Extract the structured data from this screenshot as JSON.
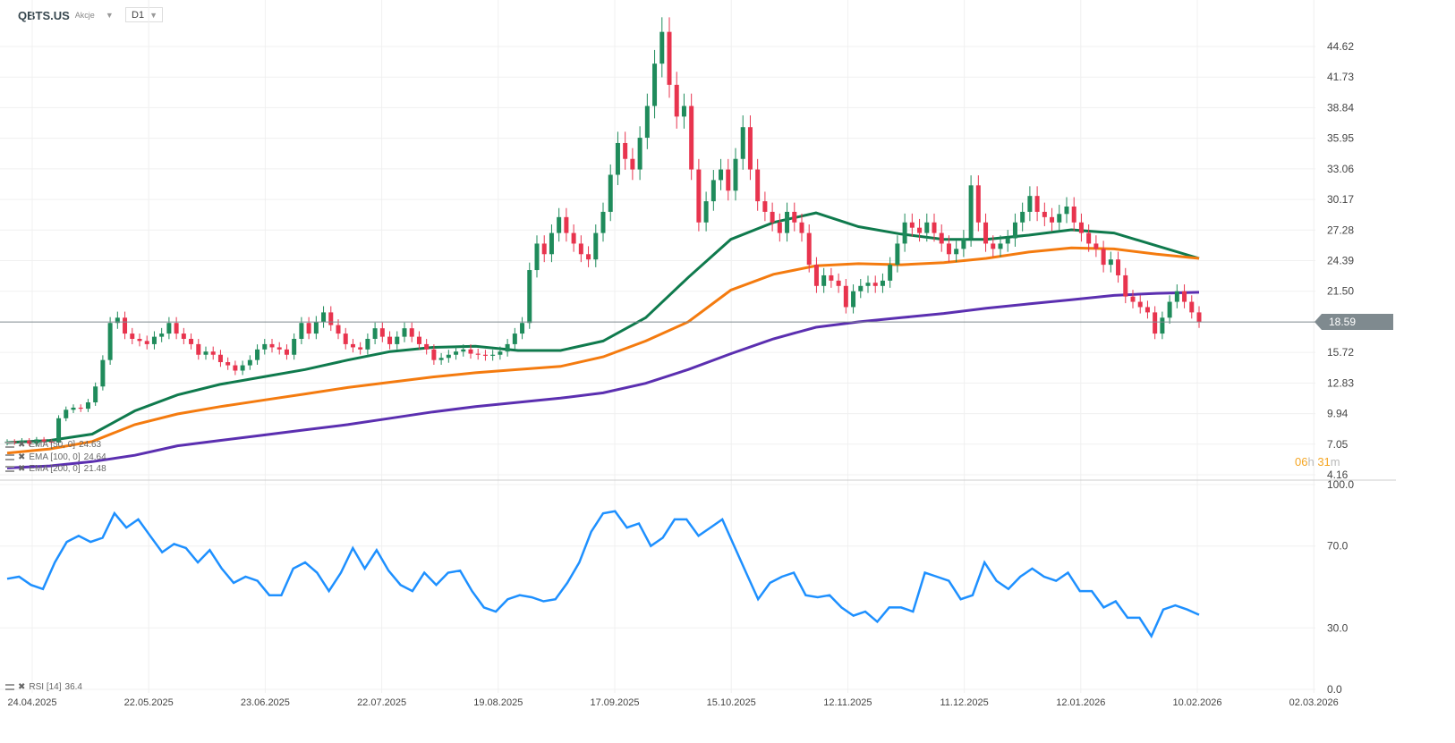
{
  "header": {
    "symbol": "QBTS.US",
    "asset_type": "Akcje",
    "timeframe": "D1"
  },
  "countdown": {
    "hours": "06",
    "h": "h",
    "minutes": "31",
    "m": "m"
  },
  "colors": {
    "up": "#1f8b5b",
    "down": "#e8344e",
    "ema50": "#0f7a4d",
    "ema100": "#f47b0f",
    "ema200": "#5b2fb0",
    "rsi": "#1e90ff",
    "last_price": "#7f8a8f"
  },
  "legend": [
    {
      "label": "EMA [50, 0]",
      "value": "24.63"
    },
    {
      "label": "EMA [100, 0]",
      "value": "24.64"
    },
    {
      "label": "EMA [200, 0]",
      "value": "21.48"
    }
  ],
  "rsi_legend": {
    "label": "RSI [14]",
    "value": "36.4"
  },
  "chart_data": [
    {
      "type": "candlestick",
      "last_price": "18.59",
      "x_range": [
        "24.04.2025",
        "10.02.2026"
      ],
      "x_ticks": [
        "24.04.2025",
        "22.05.2025",
        "23.06.2025",
        "22.07.2025",
        "19.08.2025",
        "17.09.2025",
        "15.10.2025",
        "12.11.2025",
        "11.12.2025",
        "12.01.2026",
        "10.02.2026",
        "02.03.2026"
      ],
      "y_ticks": [
        "44.62",
        "41.73",
        "38.84",
        "35.95",
        "33.06",
        "30.17",
        "27.28",
        "24.39",
        "21.50",
        "15.72",
        "12.83",
        "9.94",
        "7.05",
        "4.16"
      ],
      "ylim": [
        4.16,
        44.62
      ],
      "closes": [
        7.3,
        7.2,
        7.4,
        7.1,
        7.5,
        7.3,
        7.2,
        9.5,
        10.3,
        10.5,
        10.4,
        11,
        12.5,
        15,
        18.5,
        19,
        17.5,
        17,
        16.8,
        16.5,
        17.2,
        17.5,
        18.5,
        17.5,
        17,
        16.5,
        15.5,
        15.8,
        15.5,
        14.8,
        14.5,
        14,
        14.5,
        15,
        16,
        16.5,
        16.2,
        16,
        15.5,
        17,
        18.5,
        17.5,
        18.6,
        19.5,
        18.3,
        17.5,
        16.5,
        16.2,
        16,
        17,
        18,
        17.2,
        16.5,
        17.2,
        18,
        17.2,
        16.5,
        16,
        15,
        15.2,
        15.5,
        15.8,
        16,
        15.6,
        15.5,
        15.4,
        15.5,
        15.8,
        16.5,
        17.5,
        18.5,
        23.5,
        26,
        25,
        27,
        28.5,
        27,
        26,
        25,
        24.5,
        27,
        29,
        32.5,
        35.5,
        34,
        33,
        36,
        39,
        43,
        46,
        41,
        38,
        39,
        33,
        28,
        30,
        32,
        33,
        31,
        34,
        37,
        33,
        30,
        29,
        28,
        27,
        29,
        28,
        27,
        24,
        22,
        23,
        22.5,
        22,
        20,
        21.5,
        22,
        22.3,
        22,
        22.5,
        24,
        26,
        28,
        27.5,
        27,
        28,
        27,
        26,
        25,
        25.5,
        26.5,
        31.5,
        28,
        26,
        25.5,
        26,
        26.5,
        28,
        29,
        30.5,
        29,
        28.5,
        28,
        28.8,
        29.5,
        28,
        27,
        26,
        25.5,
        24,
        24.5,
        23,
        21,
        20.5,
        20,
        19.5,
        17.5,
        19,
        20.5,
        21.5,
        20.5,
        19.5,
        18.59
      ],
      "series": [
        {
          "name": "EMA [50, 0]",
          "values": [
            7.2,
            7.4,
            8.0,
            10.2,
            11.7,
            12.7,
            13.4,
            14.1,
            15.0,
            15.8,
            16.2,
            16.3,
            15.9,
            15.9,
            16.8,
            19,
            22.8,
            26.4,
            28,
            28.9,
            27.6,
            26.9,
            26.4,
            26.4,
            26.8,
            27.3,
            27,
            25.8,
            24.6
          ]
        },
        {
          "name": "EMA [100, 0]",
          "values": [
            6.2,
            6.6,
            7.3,
            8.9,
            9.9,
            10.6,
            11.2,
            11.8,
            12.4,
            12.9,
            13.4,
            13.8,
            14.1,
            14.4,
            15.3,
            16.8,
            18.6,
            21.6,
            23.1,
            23.9,
            24.1,
            24.0,
            24.2,
            24.6,
            25.2,
            25.6,
            25.5,
            25.0,
            24.6
          ]
        },
        {
          "name": "EMA [200, 0]",
          "values": [
            4.8,
            5.0,
            5.4,
            6.0,
            6.9,
            7.4,
            7.9,
            8.4,
            8.9,
            9.5,
            10.1,
            10.6,
            11.0,
            11.4,
            11.9,
            12.8,
            14.1,
            15.6,
            17.0,
            18.1,
            18.6,
            19.0,
            19.4,
            19.9,
            20.3,
            20.7,
            21.1,
            21.3,
            21.4
          ]
        }
      ]
    },
    {
      "type": "line",
      "name": "RSI [14]",
      "y_ticks": [
        "100.0",
        "70.0",
        "30.0",
        "0.0"
      ],
      "ylim": [
        0,
        100
      ],
      "values": [
        54,
        55,
        51,
        49,
        62,
        72,
        75,
        72,
        74,
        86,
        79,
        83,
        75,
        67,
        71,
        69,
        62,
        68,
        59,
        52,
        55,
        53,
        46,
        46,
        59,
        62,
        57,
        48,
        57,
        69,
        59,
        68,
        58,
        51,
        48,
        57,
        51,
        57,
        58,
        48,
        40,
        38,
        44,
        46,
        45,
        43,
        44,
        52,
        62,
        77,
        86,
        87,
        79,
        81,
        70,
        74,
        83,
        83,
        75,
        79,
        83,
        70,
        57,
        44,
        52,
        55,
        57,
        46,
        45,
        46,
        40,
        36,
        38,
        33,
        40,
        40,
        38,
        57,
        55,
        53,
        44,
        46,
        62,
        53,
        49,
        55,
        59,
        55,
        53,
        57,
        48,
        48,
        40,
        43,
        35,
        35,
        26,
        39,
        41,
        39,
        36.4
      ]
    }
  ]
}
